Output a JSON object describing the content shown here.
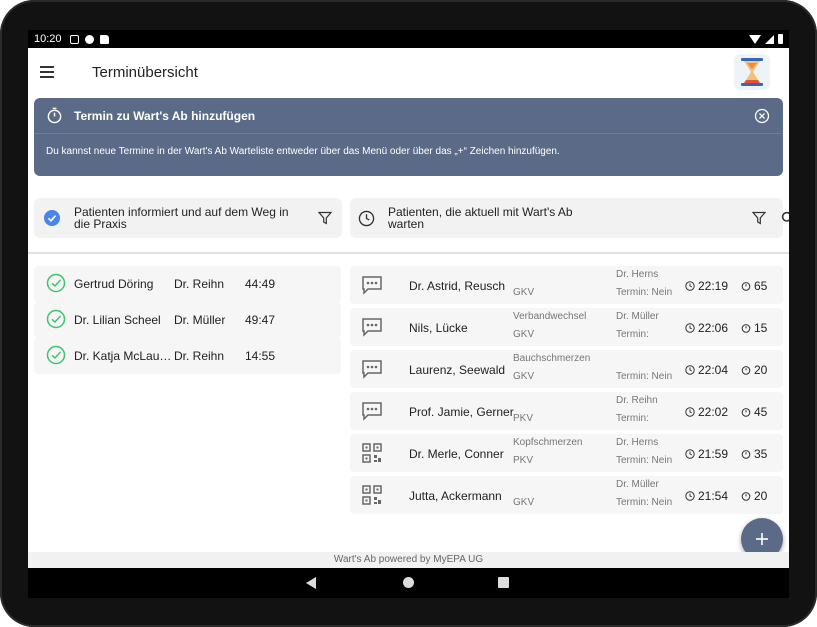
{
  "status_bar": {
    "time": "10:20"
  },
  "app_bar": {
    "title": "Terminübersicht"
  },
  "banner": {
    "title": "Termin zu Wart's Ab hinzufügen",
    "text": "Du kannst neue Termine in der Wart's Ab Warteliste entweder über das Menü oder über das „+“ Zeichen hinzufügen."
  },
  "left_panel": {
    "filter_label": "Patienten informiert und auf dem Weg in die Praxis",
    "items": [
      {
        "name": "Gertrud Döring",
        "doctor": "Dr. Reihn",
        "time": "44:49"
      },
      {
        "name": "Dr. Lilian Scheel",
        "doctor": "Dr. Müller",
        "time": "49:47"
      },
      {
        "name": "Dr. Katja McLaug...",
        "doctor": "Dr. Reihn",
        "time": "14:55"
      }
    ]
  },
  "right_panel": {
    "filter_label": "Patienten, die aktuell mit Wart's Ab warten",
    "items": [
      {
        "icon": "chat-icon",
        "name": "Dr. Astrid, Reusch",
        "reason": "",
        "insurance": "GKV",
        "doctor": "Dr. Herns",
        "termin": "Termin: Nein",
        "time": "22:19",
        "wait": "65"
      },
      {
        "icon": "chat-icon",
        "name": "Nils, Lücke",
        "reason": "Verbandwechsel",
        "insurance": "GKV",
        "doctor": "Dr. Müller",
        "termin": "Termin:",
        "time": "22:06",
        "wait": "15"
      },
      {
        "icon": "chat-icon",
        "name": "Laurenz, Seewald",
        "reason": "Bauchschmerzen",
        "insurance": "GKV",
        "doctor": "",
        "termin": "Termin: Nein",
        "time": "22:04",
        "wait": "20"
      },
      {
        "icon": "chat-icon",
        "name": "Prof. Jamie, Gerner",
        "reason": "",
        "insurance": "PKV",
        "doctor": "Dr. Reihn",
        "termin": "Termin:",
        "time": "22:02",
        "wait": "45"
      },
      {
        "icon": "qr-code-icon",
        "name": "Dr. Merle, Conner",
        "reason": "Kopfschmerzen",
        "insurance": "PKV",
        "doctor": "Dr. Herns",
        "termin": "Termin: Nein",
        "time": "21:59",
        "wait": "35"
      },
      {
        "icon": "qr-code-icon",
        "name": "Jutta, Ackermann",
        "reason": "",
        "insurance": "GKV",
        "doctor": "Dr. Müller",
        "termin": "Termin: Nein",
        "time": "21:54",
        "wait": "20"
      }
    ]
  },
  "footer": {
    "text": "Wart's Ab powered by MyEPA UG"
  },
  "colors": {
    "banner": "#5b6b87",
    "accent": "#4a86e8",
    "success": "#3cc46b"
  }
}
